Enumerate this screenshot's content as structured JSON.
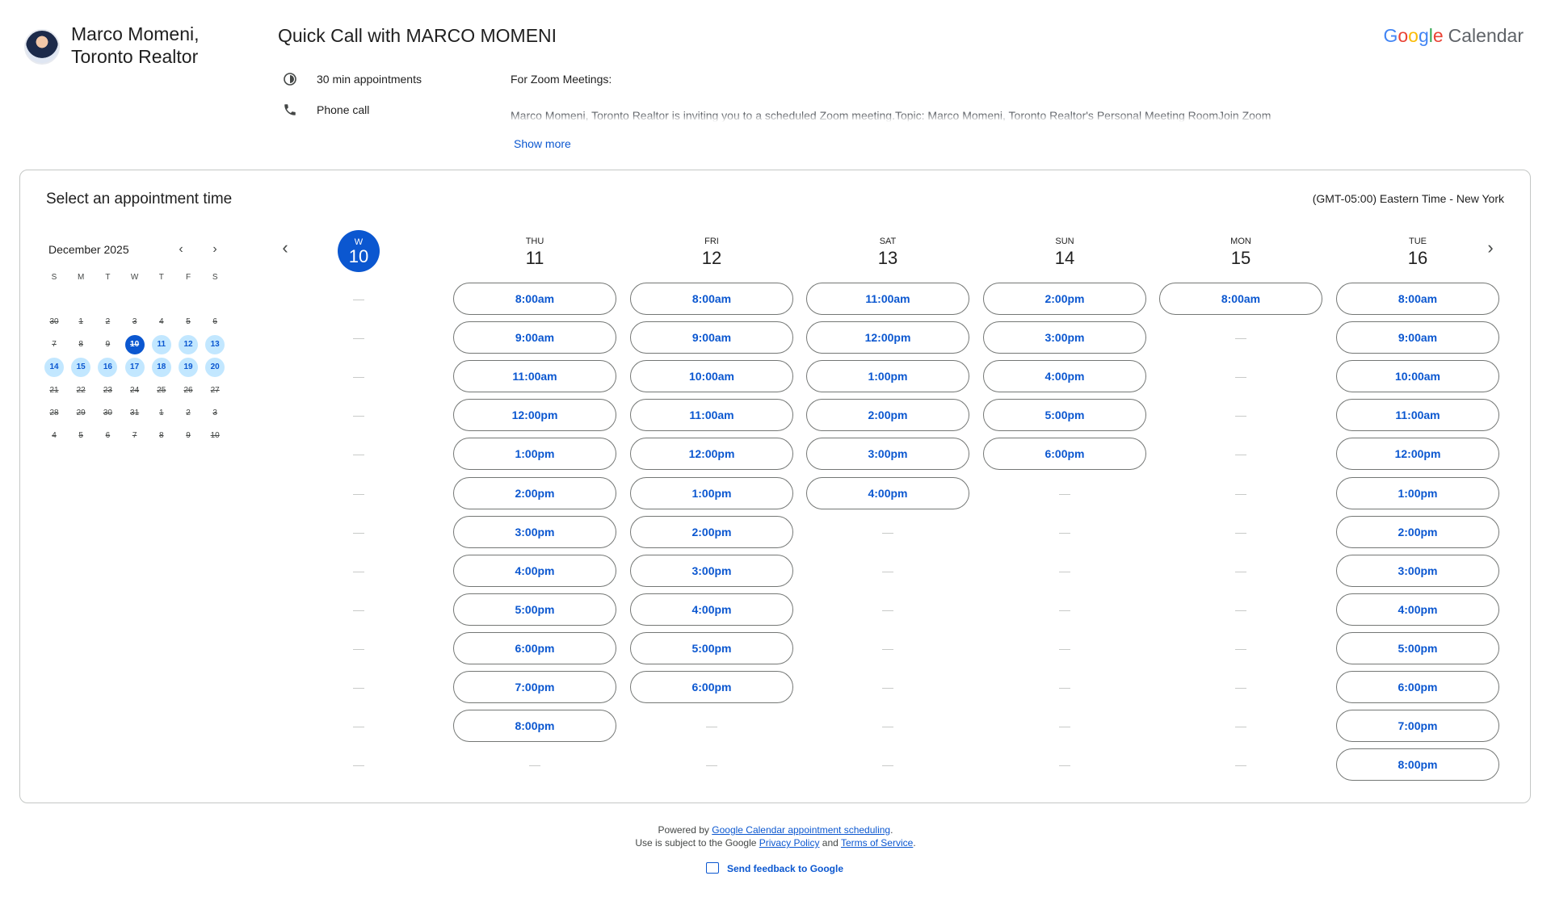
{
  "header": {
    "host_name": "Marco Momeni, Toronto Realtor",
    "host_name_line1": "Marco Momeni,",
    "host_name_line2": "Toronto Realtor",
    "title": "Quick Call with MARCO MOMENI",
    "duration": "30 min appointments",
    "location": "Phone call",
    "description_title": "For Zoom Meetings:",
    "description_body": "Marco Momeni, Toronto Realtor is inviting you to a scheduled Zoom meeting.Topic: Marco Momeni, Toronto Realtor's Personal Meeting RoomJoin Zoom",
    "show_more": "Show more",
    "brand_letters": [
      "G",
      "o",
      "o",
      "g",
      "l",
      "e"
    ],
    "brand_product": "Calendar"
  },
  "card": {
    "title": "Select an appointment time",
    "timezone": "(GMT-05:00) Eastern Time - New York"
  },
  "mini_calendar": {
    "month": "December 2025",
    "weekday_heads": [
      "S",
      "M",
      "T",
      "W",
      "T",
      "F",
      "S"
    ],
    "weeks": [
      [
        {
          "d": "30",
          "s": "past"
        },
        {
          "d": "1",
          "s": "past"
        },
        {
          "d": "2",
          "s": "past"
        },
        {
          "d": "3",
          "s": "past"
        },
        {
          "d": "4",
          "s": "past"
        },
        {
          "d": "5",
          "s": "past"
        },
        {
          "d": "6",
          "s": "past"
        }
      ],
      [
        {
          "d": "7",
          "s": "past"
        },
        {
          "d": "8",
          "s": "past"
        },
        {
          "d": "9",
          "s": "past"
        },
        {
          "d": "10",
          "s": "sel"
        },
        {
          "d": "11",
          "s": "avail"
        },
        {
          "d": "12",
          "s": "avail"
        },
        {
          "d": "13",
          "s": "avail"
        }
      ],
      [
        {
          "d": "14",
          "s": "avail"
        },
        {
          "d": "15",
          "s": "avail"
        },
        {
          "d": "16",
          "s": "avail"
        },
        {
          "d": "17",
          "s": "avail"
        },
        {
          "d": "18",
          "s": "avail"
        },
        {
          "d": "19",
          "s": "avail"
        },
        {
          "d": "20",
          "s": "avail"
        }
      ],
      [
        {
          "d": "21",
          "s": "past"
        },
        {
          "d": "22",
          "s": "past"
        },
        {
          "d": "23",
          "s": "past"
        },
        {
          "d": "24",
          "s": "past"
        },
        {
          "d": "25",
          "s": "past"
        },
        {
          "d": "26",
          "s": "past"
        },
        {
          "d": "27",
          "s": "past"
        }
      ],
      [
        {
          "d": "28",
          "s": "past"
        },
        {
          "d": "29",
          "s": "past"
        },
        {
          "d": "30",
          "s": "past"
        },
        {
          "d": "31",
          "s": "past"
        },
        {
          "d": "1",
          "s": "past"
        },
        {
          "d": "2",
          "s": "past"
        },
        {
          "d": "3",
          "s": "past"
        }
      ],
      [
        {
          "d": "4",
          "s": "past"
        },
        {
          "d": "5",
          "s": "past"
        },
        {
          "d": "6",
          "s": "past"
        },
        {
          "d": "7",
          "s": "past"
        },
        {
          "d": "8",
          "s": "past"
        },
        {
          "d": "9",
          "s": "past"
        },
        {
          "d": "10",
          "s": "past"
        }
      ]
    ]
  },
  "week": {
    "today": {
      "dow": "W",
      "day": "10"
    },
    "days": [
      {
        "dow": "THU",
        "day": "11",
        "slots": [
          "8:00am",
          "9:00am",
          "11:00am",
          "12:00pm",
          "1:00pm",
          "2:00pm",
          "3:00pm",
          "4:00pm",
          "5:00pm",
          "6:00pm",
          "7:00pm",
          "8:00pm"
        ]
      },
      {
        "dow": "FRI",
        "day": "12",
        "slots": [
          "8:00am",
          "9:00am",
          "10:00am",
          "11:00am",
          "12:00pm",
          "1:00pm",
          "2:00pm",
          "3:00pm",
          "4:00pm",
          "5:00pm",
          "6:00pm"
        ]
      },
      {
        "dow": "SAT",
        "day": "13",
        "slots": [
          "11:00am",
          "12:00pm",
          "1:00pm",
          "2:00pm",
          "3:00pm",
          "4:00pm"
        ]
      },
      {
        "dow": "SUN",
        "day": "14",
        "slots": [
          "2:00pm",
          "3:00pm",
          "4:00pm",
          "5:00pm",
          "6:00pm"
        ]
      },
      {
        "dow": "MON",
        "day": "15",
        "slots": [
          "8:00am"
        ]
      },
      {
        "dow": "TUE",
        "day": "16",
        "slots": [
          "8:00am",
          "9:00am",
          "10:00am",
          "11:00am",
          "12:00pm",
          "1:00pm",
          "2:00pm",
          "3:00pm",
          "4:00pm",
          "5:00pm",
          "6:00pm",
          "7:00pm",
          "8:00pm"
        ]
      }
    ],
    "empty_placeholder": "—",
    "rows": 13
  },
  "footer": {
    "powered_by": "Powered by",
    "powered_link": "Google Calendar appointment scheduling",
    "powered_end": ".",
    "terms_prefix": "Use is subject to the Google",
    "privacy": "Privacy Policy",
    "and": "and",
    "terms": "Terms of Service",
    "terms_end": ".",
    "feedback": "Send feedback to Google"
  },
  "colors": {
    "accent": "#0b57d0",
    "available_day_bg": "#c2e7ff",
    "border": "#c4c7c5"
  }
}
